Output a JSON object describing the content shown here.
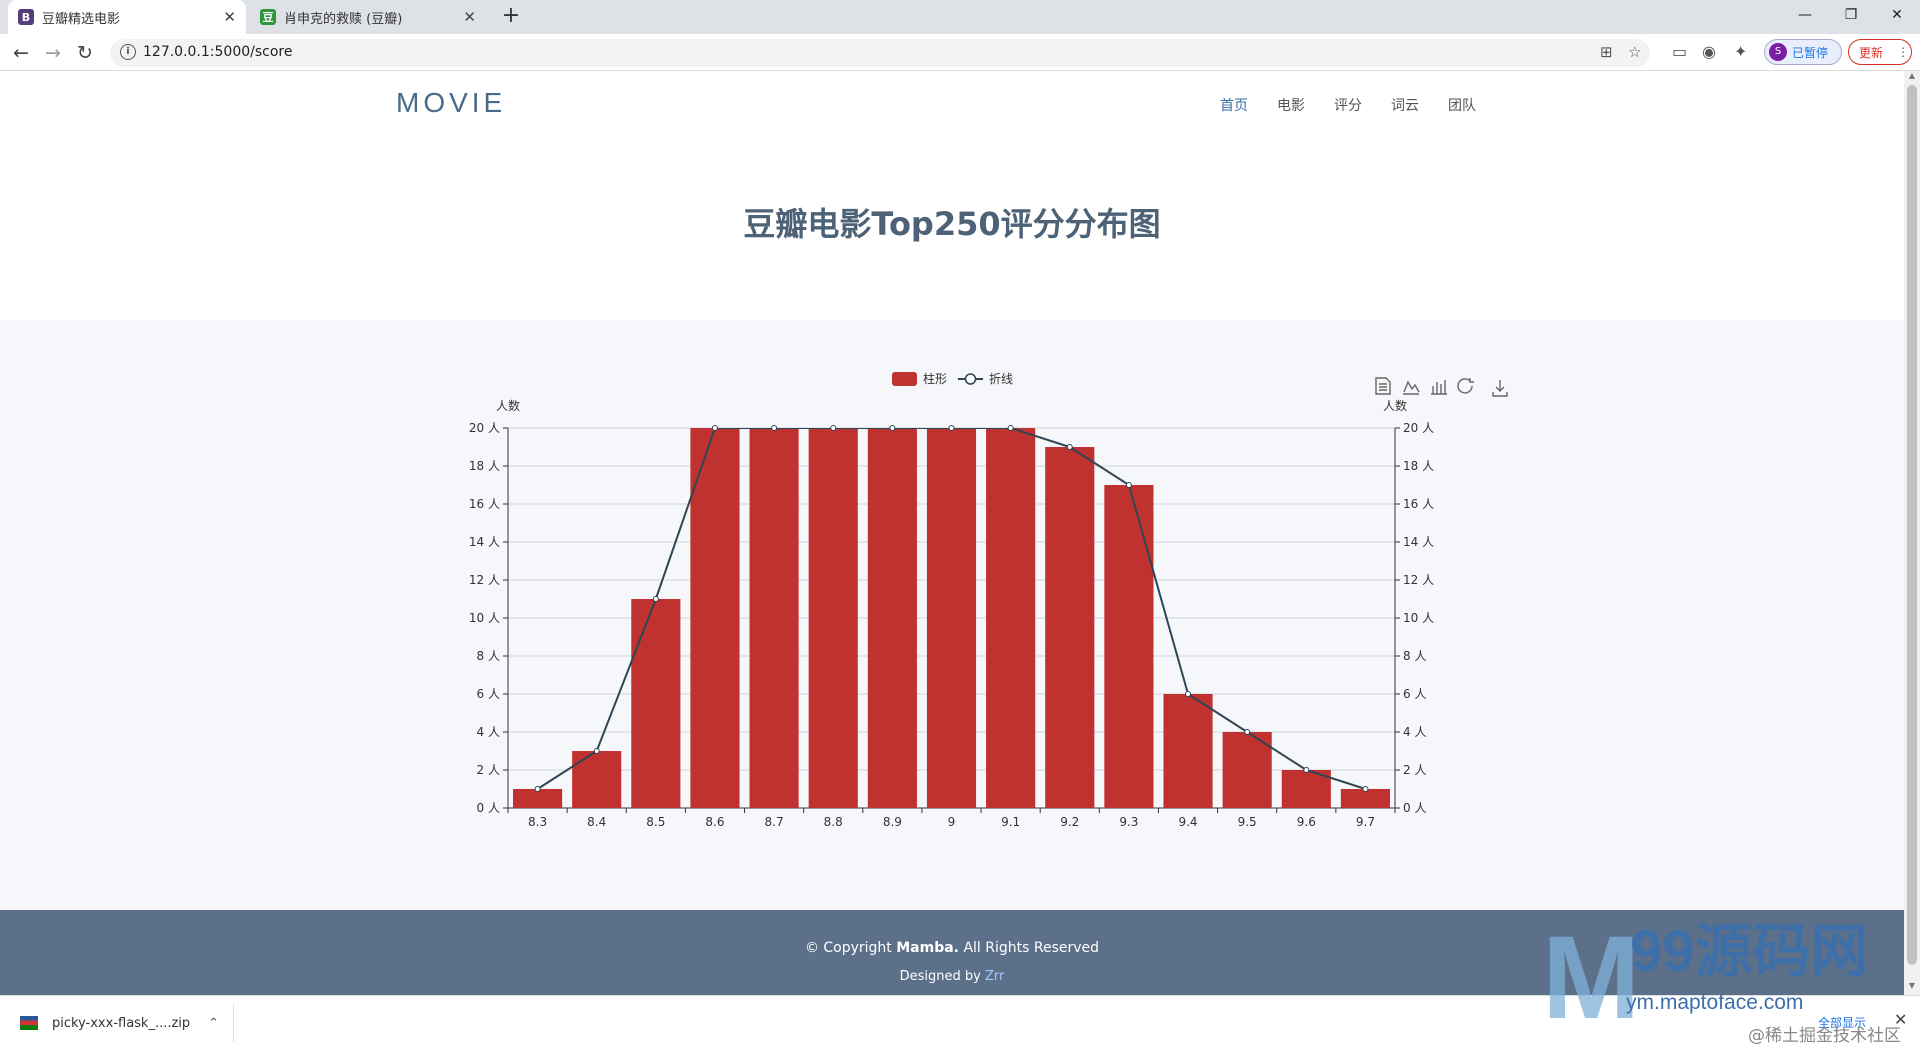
{
  "browser": {
    "tabs": [
      {
        "title": "豆瓣精选电影",
        "favicon": "B",
        "favicon_color": "#563d7c",
        "active": true
      },
      {
        "title": "肖申克的救赎 (豆瓣)",
        "favicon": "豆",
        "favicon_color": "#2e963d",
        "active": false
      }
    ],
    "url": "127.0.0.1:5000/score",
    "profile_label": "已暂停",
    "profile_initial": "S",
    "update_label": "更新"
  },
  "header": {
    "brand": "MOVIE",
    "nav": [
      "首页",
      "电影",
      "评分",
      "词云",
      "团队"
    ],
    "active_nav": "首页"
  },
  "page": {
    "title": "豆瓣电影Top250评分分布图"
  },
  "chart_data": {
    "type": "bar",
    "categories": [
      "8.3",
      "8.4",
      "8.5",
      "8.6",
      "8.7",
      "8.8",
      "8.9",
      "9",
      "9.1",
      "9.2",
      "9.3",
      "9.4",
      "9.5",
      "9.6",
      "9.7"
    ],
    "series": [
      {
        "name": "柱形",
        "type": "bar",
        "values": [
          1,
          3,
          11,
          20,
          20,
          20,
          20,
          20,
          20,
          19,
          17,
          6,
          4,
          2,
          1
        ],
        "color": "#c03230"
      },
      {
        "name": "折线",
        "type": "line",
        "values": [
          1,
          3,
          11,
          20,
          20,
          20,
          20,
          20,
          20,
          19,
          17,
          6,
          4,
          2,
          1
        ],
        "color": "#2f4554"
      }
    ],
    "ylabel_left": "人数",
    "ylabel_right": "人数",
    "ylim": [
      0,
      20
    ],
    "ytick_step": 2,
    "ytick_unit": " 人",
    "grid": true,
    "legend_position": "top-center"
  },
  "footer": {
    "copyright_prefix": "© Copyright ",
    "copyright_name": "Mamba.",
    "copyright_suffix": " All Rights Reserved",
    "designed_prefix": "Designed by ",
    "designed_name": "Zrr"
  },
  "downloads": {
    "file": "picky-xxx-flask_....zip",
    "show_all": "全部显示"
  },
  "watermark": {
    "brand": "99源码网",
    "domain": "ym.maptoface.com",
    "sub": "@稀土掘金技术社区"
  }
}
